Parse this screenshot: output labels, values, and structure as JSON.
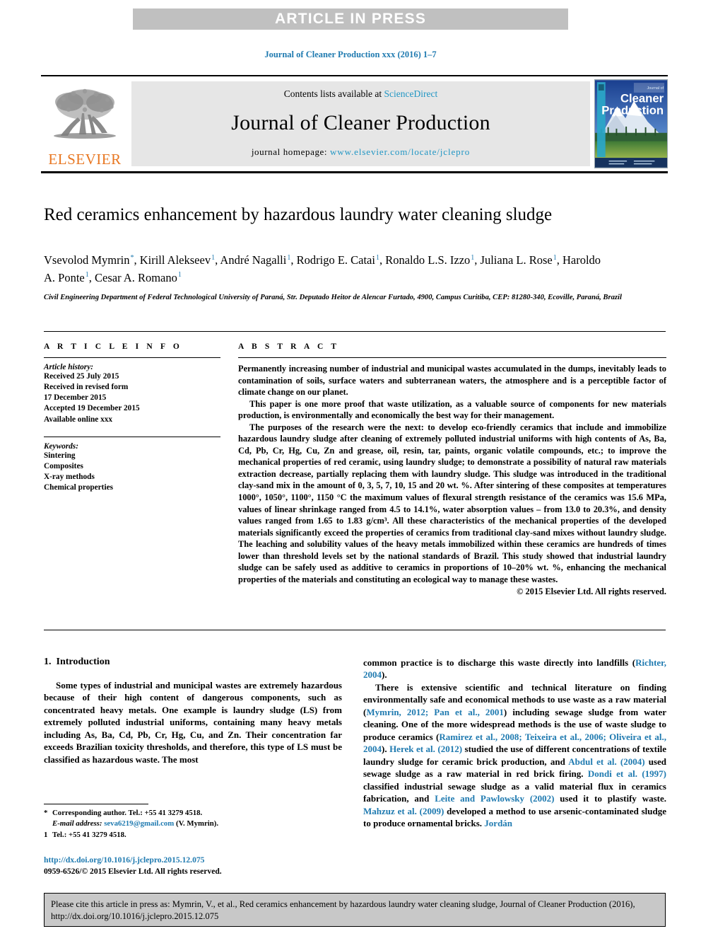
{
  "banner": {
    "text": "ARTICLE IN PRESS"
  },
  "running_head": "Journal of Cleaner Production xxx (2016) 1–7",
  "masthead": {
    "contents_prefix": "Contents lists available at ",
    "sciencedirect": "ScienceDirect",
    "journal_name": "Journal of Cleaner Production",
    "homepage_label": "journal homepage: ",
    "homepage_url": "www.elsevier.com/locate/jclepro",
    "publisher": "ELSEVIER",
    "cover_title_small": "Journal of",
    "cover_title_line1": "Cleaner",
    "cover_title_line2": "Production"
  },
  "article": {
    "title": "Red ceramics enhancement by hazardous laundry water cleaning sludge",
    "authors": [
      {
        "name": "Vsevolod Mymrin",
        "sup": "*",
        "sep": ", "
      },
      {
        "name": "Kirill Alekseev",
        "sup": "1",
        "sep": ", "
      },
      {
        "name": "André Nagalli",
        "sup": "1",
        "sep": ", "
      },
      {
        "name": "Rodrigo E. Catai",
        "sup": "1",
        "sep": ", "
      },
      {
        "name": "Ronaldo L.S. Izzo",
        "sup": "1",
        "sep": ", "
      },
      {
        "name": "Juliana L. Rose",
        "sup": "1",
        "sep": ", "
      },
      {
        "name": "Haroldo A. Ponte",
        "sup": "1",
        "sep": ", "
      },
      {
        "name": "Cesar A. Romano",
        "sup": "1",
        "sep": ""
      }
    ],
    "affiliation": "Civil Engineering Department of Federal Technological University of Paraná, Str. Deputado Heitor de Alencar Furtado, 4900, Campus Curitiba, CEP: 81280-340, Ecoville, Paraná, Brazil"
  },
  "article_info": {
    "label": "A R T I C L E   I N F O",
    "history_label": "Article history:",
    "history": [
      "Received 25 July 2015",
      "Received in revised form",
      "17 December 2015",
      "Accepted 19 December 2015",
      "Available online xxx"
    ],
    "keywords_label": "Keywords:",
    "keywords": [
      "Sintering",
      "Composites",
      "X-ray methods",
      "Chemical properties"
    ]
  },
  "abstract": {
    "label": "A B S T R A C T",
    "paragraphs": [
      "Permanently increasing number of industrial and municipal wastes accumulated in the dumps, inevitably leads to contamination of soils, surface waters and subterranean waters, the atmosphere and is a perceptible factor of climate change on our planet.",
      "This paper is one more proof that waste utilization, as a valuable source of components for new materials production, is environmentally and economically the best way for their management.",
      "The purposes of the research were the next: to develop eco-friendly ceramics that include and immobilize hazardous laundry sludge after cleaning of extremely polluted industrial uniforms with high contents of As, Ba, Cd, Pb, Cr, Hg, Cu, Zn and grease, oil, resin, tar, paints, organic volatile compounds, etc.; to improve the mechanical properties of red ceramic, using laundry sludge; to demonstrate a possibility of natural raw materials extraction decrease, partially replacing them with laundry sludge. This sludge was introduced in the traditional clay-sand mix in the amount of 0, 3, 5, 7, 10, 15 and 20 wt. %. After sintering of these composites at temperatures 1000°, 1050°, 1100°, 1150 °C the maximum values of flexural strength resistance of the ceramics was 15.6 MPa, values of linear shrinkage ranged from 4.5 to 14.1%, water absorption values – from 13.0 to 20.3%, and density values ranged from 1.65 to 1.83 g/cm³. All these characteristics of the mechanical properties of the developed materials significantly exceed the properties of ceramics from traditional clay-sand mixes without laundry sludge. The leaching and solubility values of the heavy metals immobilized within these ceramics are hundreds of times lower than threshold levels set by the national standards of Brazil. This study showed that industrial laundry sludge can be safely used as additive to ceramics in proportions of 10–20% wt. %, enhancing the mechanical properties of the materials and constituting an ecological way to manage these wastes."
    ],
    "copyright": "© 2015 Elsevier Ltd. All rights reserved."
  },
  "introduction": {
    "number": "1.",
    "heading": "Introduction",
    "left_paragraph": "Some types of industrial and municipal wastes are extremely hazardous because of their high content of dangerous components, such as concentrated heavy metals. One example is laundry sludge (LS) from extremely polluted industrial uniforms, containing many heavy metals including As, Ba, Cd, Pb, Cr, Hg, Cu, and Zn. Their concentration far exceeds Brazilian toxicity thresholds, and therefore, this type of LS must be classified as hazardous waste. The most"
  },
  "right_column": {
    "para1": {
      "pre": "common practice is to discharge this waste directly into landfills (",
      "cite": "Richter, 2004",
      "post": ")."
    },
    "para2_segments": [
      {
        "text": "There is extensive scientific and technical literature on finding environmentally safe and economical methods to use waste as a raw material (",
        "cite": false
      },
      {
        "text": "Mymrin, 2012; Pan et al., 2001",
        "cite": true
      },
      {
        "text": ") including sewage sludge from water cleaning. One of the more widespread methods is the use of waste sludge to produce ceramics (",
        "cite": false
      },
      {
        "text": "Ramirez et al., 2008; Teixeira et al., 2006; Oliveira et al., 2004",
        "cite": true
      },
      {
        "text": "). ",
        "cite": false
      },
      {
        "text": "Herek et al. (2012)",
        "cite": true
      },
      {
        "text": " studied the use of different concentrations of textile laundry sludge for ceramic brick production, and ",
        "cite": false
      },
      {
        "text": "Abdul et al. (2004)",
        "cite": true
      },
      {
        "text": " used sewage sludge as a raw material in red brick firing. ",
        "cite": false
      },
      {
        "text": "Dondi et al. (1997)",
        "cite": true
      },
      {
        "text": " classified industrial sewage sludge as a valid material flux in ceramics fabrication, and ",
        "cite": false
      },
      {
        "text": "Leite and Pawlowsky (2002)",
        "cite": true
      },
      {
        "text": " used it to plastify waste. ",
        "cite": false
      },
      {
        "text": "Mahzuz et al. (2009)",
        "cite": true
      },
      {
        "text": " developed a method to use arsenic-contaminated sludge to produce ornamental bricks. ",
        "cite": false
      },
      {
        "text": "Jordán",
        "cite": true
      }
    ]
  },
  "footnotes": {
    "corresponding": "Corresponding author. Tel.: +55 41 3279 4518.",
    "corresponding_mark": "*",
    "email_label": "E-mail address: ",
    "email": "seva6219@gmail.com",
    "email_suffix": " (V. Mymrin).",
    "note1_mark": "1",
    "note1": "Tel.: +55 41 3279 4518.",
    "doi": "http://dx.doi.org/10.1016/j.jclepro.2015.12.075",
    "issn": "0959-6526/© 2015 Elsevier Ltd. All rights reserved."
  },
  "citation_box": {
    "text": "Please cite this article in press as: Mymrin, V., et al., Red ceramics enhancement by hazardous laundry water cleaning sludge, Journal of Cleaner Production (2016), http://dx.doi.org/10.1016/j.jclepro.2015.12.075"
  },
  "colors": {
    "link_blue": "#1f7ab0",
    "sciencedirect_blue": "#2196c4",
    "elsevier_orange": "#e87722",
    "banner_gray": "#c0c0c0",
    "masthead_gray": "#e6e6e6",
    "citation_gray": "#c8c8c8"
  }
}
